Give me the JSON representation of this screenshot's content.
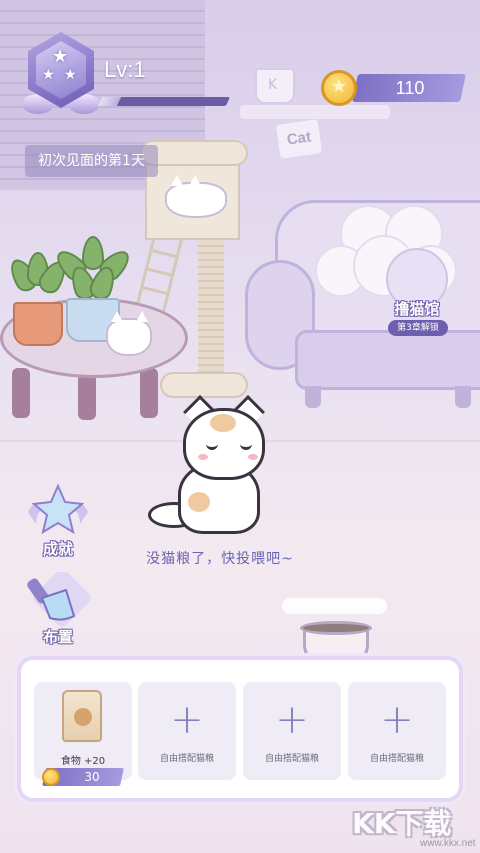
{
  "player": {
    "level_label": "Lv:1",
    "level_progress": 0.15,
    "coins": "110",
    "day_label": "初次见面的第1天"
  },
  "gallery": {
    "title": "撸猫馆",
    "lock_text": "第3章解锁"
  },
  "side_menu": {
    "achievements_label": "成就",
    "decorate_label": "布置"
  },
  "scene": {
    "speech": "没猫粮了，快投喂吧~",
    "sign_text": "Cat",
    "cup_letter": "K"
  },
  "food_panel": {
    "item": {
      "name": "食物 +20",
      "price": "30"
    },
    "empty_slot_label": "自由搭配猫粮",
    "empty_slots": [
      {
        "label": "自由搭配猫粮"
      },
      {
        "label": "自由搭配猫粮"
      },
      {
        "label": "自由搭配猫粮"
      }
    ]
  },
  "watermark": {
    "text": "KK下载",
    "url": "www.kkx.net"
  },
  "colors": {
    "accent_purple": "#7e6fc3",
    "coin_gold": "#f2b43a",
    "text_blue": "#6b64b6"
  }
}
